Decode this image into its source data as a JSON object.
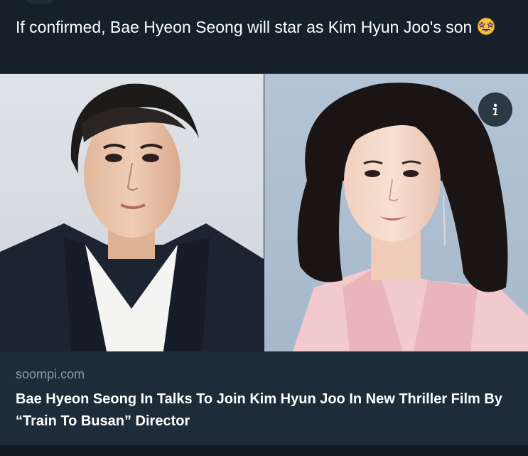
{
  "tweet": {
    "text": "If confirmed, Bae Hyeon Seong will star as Kim Hyun Joo's son",
    "emoji_icon": "star-struck-face-icon"
  },
  "card": {
    "domain": "soompi.com",
    "headline": "Bae Hyeon Seong In Talks To Join Kim Hyun Joo In New Thriller Film By “Train To Busan” Director",
    "info_icon": "info-icon",
    "left_photo": "actor-portrait",
    "right_photo": "actress-portrait"
  },
  "colors": {
    "background": "#15202b",
    "card_body": "#1e2b38",
    "domain_text": "#8b98a5"
  }
}
